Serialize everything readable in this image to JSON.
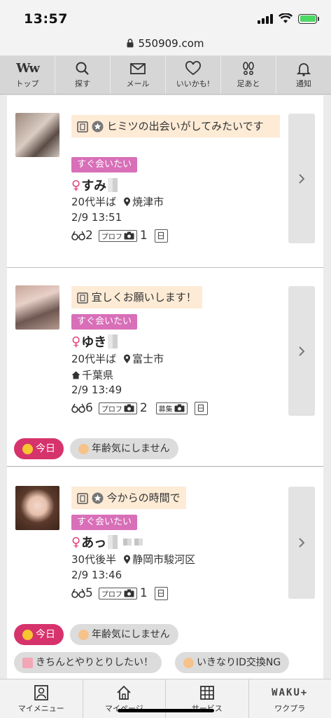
{
  "status_bar": {
    "time": "13:57"
  },
  "url_bar": {
    "url": "550909.com"
  },
  "top_nav": [
    {
      "label": "トップ",
      "icon": "ww-logo-icon"
    },
    {
      "label": "探す",
      "icon": "search-icon"
    },
    {
      "label": "メール",
      "icon": "mail-icon"
    },
    {
      "label": "いいかも!",
      "icon": "heart-icon"
    },
    {
      "label": "足あと",
      "icon": "footprint-icon"
    },
    {
      "label": "通知",
      "icon": "bell-icon"
    }
  ],
  "logo_text": "Ww",
  "cards": [
    {
      "message": "ヒミツの出会いがしてみたいです",
      "tag": "すぐ会いたい",
      "female_symbol": "♀",
      "name": "すみ",
      "age": "20代半ば",
      "location": "焼津市",
      "datetime": "2/9 13:51",
      "views": "2",
      "prof_label": "プロフ",
      "prof_photos": "1"
    },
    {
      "message": "宜しくお願いします！",
      "tag": "すぐ会いたい",
      "female_symbol": "♀",
      "name": "ゆき",
      "age": "20代半ば",
      "location": "富士市",
      "hometown": "千葉県",
      "datetime": "2/9 13:49",
      "views": "6",
      "prof_label": "プロフ",
      "prof_photos": "2",
      "recruit_label": "募集"
    },
    {
      "message": "今からの時間で",
      "tag": "すぐ会いたい",
      "female_symbol": "♀",
      "name": "あっ",
      "age": "30代後半",
      "location": "静岡市駿河区",
      "datetime": "2/9 13:46",
      "views": "5",
      "prof_label": "プロフ",
      "prof_photos": "1"
    }
  ],
  "chips_1": {
    "today": "今日",
    "age": "年齢気にしません"
  },
  "chips_2": {
    "today": "今日",
    "age": "年齢気にしません",
    "chat": "きちんとやりとりしたい！",
    "ng": "いきなりID交換NG"
  },
  "bottom_nav": [
    {
      "label": "マイメニュー",
      "icon": "profile-icon"
    },
    {
      "label": "マイページ",
      "icon": "home-icon"
    },
    {
      "label": "サービス",
      "icon": "grid-icon"
    },
    {
      "label": "ワクプラ",
      "icon": "waku-plus-logo"
    }
  ],
  "waku_text": "WAKU+",
  "colors": {
    "tag": "#d86fb8",
    "today_chip": "#d6336c",
    "bubble": "#fdebd6",
    "female": "#e0447b"
  }
}
